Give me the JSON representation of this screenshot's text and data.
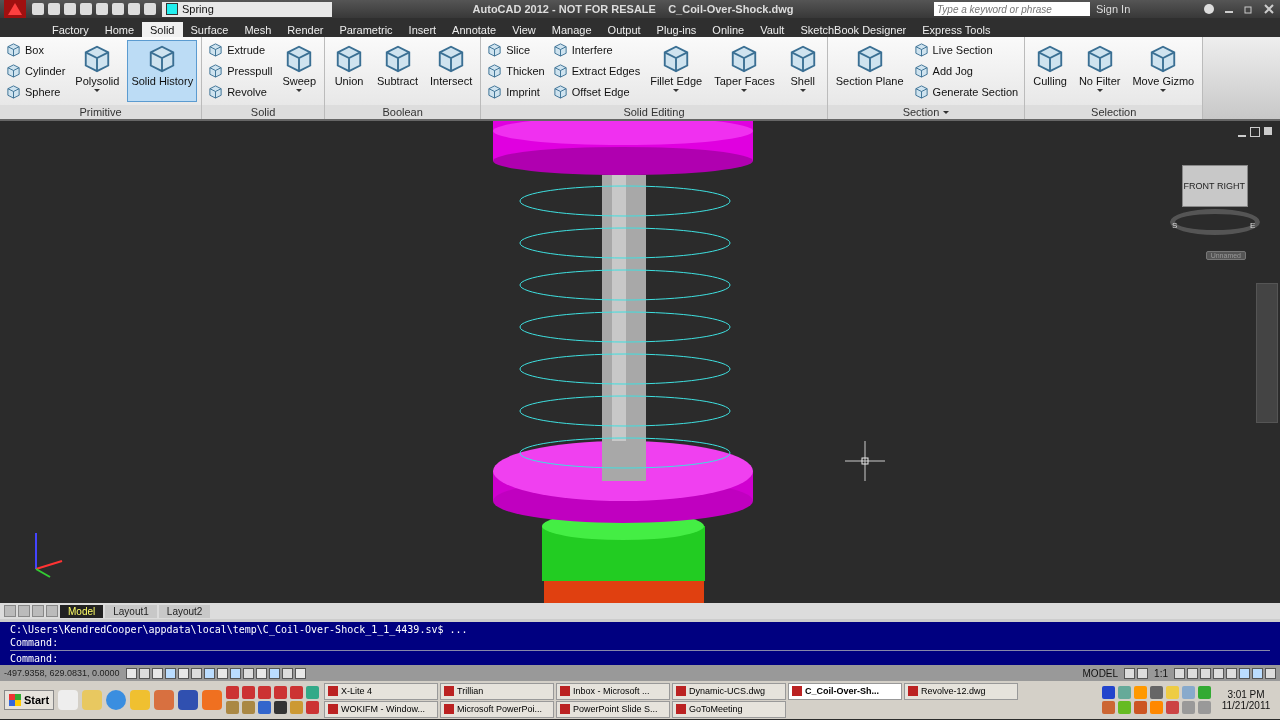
{
  "title_bar": {
    "layer": "Spring",
    "title": "AutoCAD 2012 - NOT FOR RESALE    C_Coil-Over-Shock.dwg",
    "search": {
      "placeholder": "Type a keyword or phrase"
    },
    "sign_in": "Sign In"
  },
  "tabs": [
    {
      "label": "Factory",
      "selected": false
    },
    {
      "label": "Home",
      "selected": false
    },
    {
      "label": "Solid",
      "selected": true
    },
    {
      "label": "Surface",
      "selected": false
    },
    {
      "label": "Mesh",
      "selected": false
    },
    {
      "label": "Render",
      "selected": false
    },
    {
      "label": "Parametric",
      "selected": false
    },
    {
      "label": "Insert",
      "selected": false
    },
    {
      "label": "Annotate",
      "selected": false
    },
    {
      "label": "View",
      "selected": false
    },
    {
      "label": "Manage",
      "selected": false
    },
    {
      "label": "Output",
      "selected": false
    },
    {
      "label": "Plug-ins",
      "selected": false
    },
    {
      "label": "Online",
      "selected": false
    },
    {
      "label": "Vault",
      "selected": false
    },
    {
      "label": "SketchBook Designer",
      "selected": false
    },
    {
      "label": "Express Tools",
      "selected": false
    }
  ],
  "ribbon": [
    {
      "title": "Primitive",
      "title_dropdown": false,
      "groups": [
        {
          "kind": "stack",
          "items": [
            "Box",
            "Cylinder",
            "Sphere"
          ]
        },
        {
          "kind": "large",
          "label": "Polysolid",
          "dropdown": true,
          "selected": false
        },
        {
          "kind": "large",
          "label": "Solid History",
          "dropdown": false,
          "selected": true
        }
      ]
    },
    {
      "title": "Solid",
      "title_dropdown": false,
      "groups": [
        {
          "kind": "stack",
          "items": [
            "Extrude",
            "Presspull",
            "Revolve"
          ]
        },
        {
          "kind": "large",
          "label": "Sweep",
          "dropdown": true,
          "selected": false
        }
      ]
    },
    {
      "title": "Boolean",
      "title_dropdown": false,
      "groups": [
        {
          "kind": "large",
          "label": "Union",
          "dropdown": false,
          "selected": false
        },
        {
          "kind": "large",
          "label": "Subtract",
          "dropdown": false,
          "selected": false
        },
        {
          "kind": "large",
          "label": "Intersect",
          "dropdown": false,
          "selected": false
        }
      ]
    },
    {
      "title": "Solid Editing",
      "title_dropdown": false,
      "groups": [
        {
          "kind": "stack",
          "items": [
            "Slice",
            "Thicken",
            "Imprint"
          ]
        },
        {
          "kind": "stack",
          "items": [
            "Interfere",
            "Extract Edges",
            "Offset Edge"
          ]
        },
        {
          "kind": "large",
          "label": "Fillet Edge",
          "dropdown": true,
          "selected": false
        },
        {
          "kind": "large",
          "label": "Taper Faces",
          "dropdown": true,
          "selected": false
        },
        {
          "kind": "large",
          "label": "Shell",
          "dropdown": true,
          "selected": false
        }
      ]
    },
    {
      "title": "Section",
      "title_dropdown": true,
      "groups": [
        {
          "kind": "large",
          "label": "Section Plane",
          "dropdown": false,
          "selected": false
        },
        {
          "kind": "stack",
          "items": [
            "Live Section",
            "Add Jog",
            "Generate Section"
          ]
        }
      ]
    },
    {
      "title": "Selection",
      "title_dropdown": false,
      "groups": [
        {
          "kind": "large",
          "label": "Culling",
          "dropdown": false,
          "selected": false
        },
        {
          "kind": "large",
          "label": "No Filter",
          "dropdown": true,
          "selected": false
        },
        {
          "kind": "large",
          "label": "Move Gizmo",
          "dropdown": true,
          "selected": false
        }
      ]
    }
  ],
  "view_cube": {
    "faces": [
      "FRONT",
      "RIGHT"
    ],
    "compass": [
      "S",
      "E"
    ],
    "menu": "Unnamed"
  },
  "layout_tabs": [
    {
      "label": "Model",
      "selected": true
    },
    {
      "label": "Layout1",
      "selected": false
    },
    {
      "label": "Layout2",
      "selected": false
    }
  ],
  "command_lines": [
    "C:\\Users\\KendredCooper\\appdata\\local\\temp\\C_Coil-Over-Shock_1_1_4439.sv$ ...",
    "Command:",
    "Command:"
  ],
  "status_bar": {
    "coordinates": "-497.9358, 629.0831, 0.0000",
    "space": "MODEL",
    "scale": "1:1"
  },
  "taskbar": {
    "start": "Start",
    "rows": [
      [
        {
          "label": "X-Lite 4",
          "selected": false
        },
        {
          "label": "Trillian",
          "selected": false
        },
        {
          "label": "Inbox - Microsoft ...",
          "selected": false
        },
        {
          "label": "Dynamic-UCS.dwg",
          "selected": false
        },
        {
          "label": "C_Coil-Over-Sh...",
          "selected": true
        },
        {
          "label": "Revolve-12.dwg",
          "selected": false
        }
      ],
      [
        {
          "label": "WOKIFM - Window...",
          "selected": false
        },
        {
          "label": "Microsoft PowerPoi...",
          "selected": false
        },
        {
          "label": "PowerPoint Slide S...",
          "selected": false
        },
        {
          "label": "GoToMeeting",
          "selected": false
        }
      ]
    ],
    "time": "3:01 PM",
    "date": "11/21/2011"
  }
}
